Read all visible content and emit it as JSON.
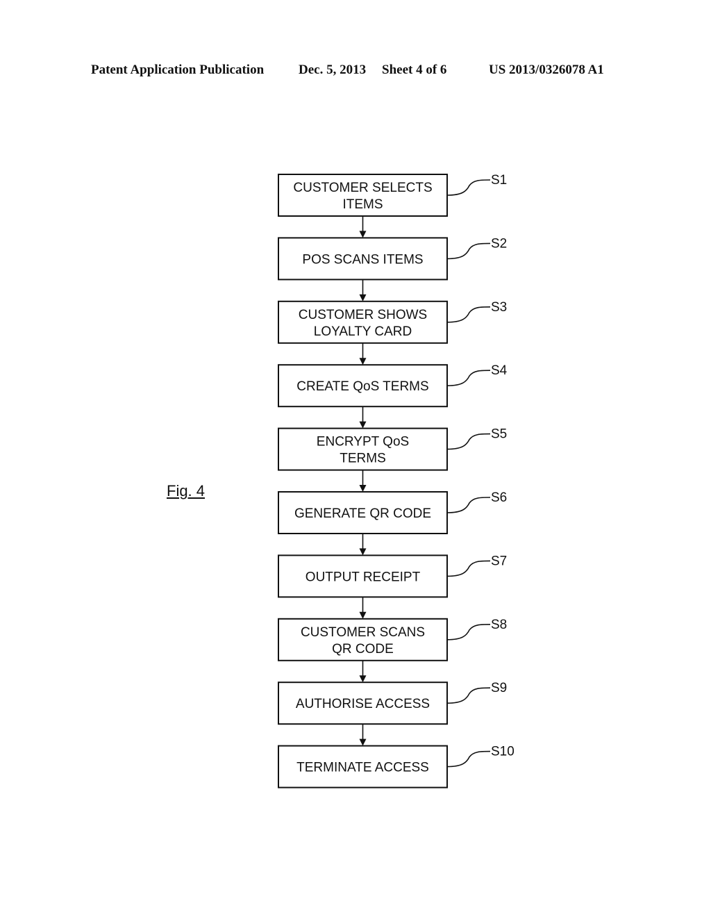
{
  "header": {
    "publication_type": "Patent Application Publication",
    "date": "Dec. 5, 2013",
    "sheet": "Sheet 4 of 6",
    "pub_number": "US 2013/0326078 A1"
  },
  "figure": {
    "label": "Fig. 4",
    "steps": [
      {
        "id": "S1",
        "lines": [
          "CUSTOMER SELECTS",
          "ITEMS"
        ]
      },
      {
        "id": "S2",
        "lines": [
          "POS SCANS ITEMS"
        ]
      },
      {
        "id": "S3",
        "lines": [
          "CUSTOMER SHOWS",
          "LOYALTY CARD"
        ]
      },
      {
        "id": "S4",
        "lines": [
          "CREATE QoS TERMS"
        ]
      },
      {
        "id": "S5",
        "lines": [
          "ENCRYPT QoS",
          "TERMS"
        ]
      },
      {
        "id": "S6",
        "lines": [
          "GENERATE QR CODE"
        ]
      },
      {
        "id": "S7",
        "lines": [
          "OUTPUT RECEIPT"
        ]
      },
      {
        "id": "S8",
        "lines": [
          "CUSTOMER SCANS",
          "QR CODE"
        ]
      },
      {
        "id": "S9",
        "lines": [
          "AUTHORISE ACCESS"
        ]
      },
      {
        "id": "S10",
        "lines": [
          "TERMINATE ACCESS"
        ]
      }
    ]
  }
}
